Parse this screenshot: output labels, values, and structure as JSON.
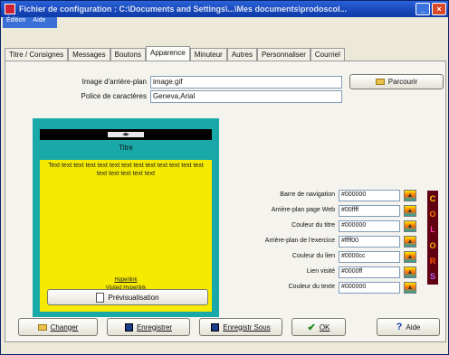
{
  "window": {
    "title": "Fichier de configuration : C:\\Documents and Settings\\...\\Mes documents\\prodoscol...",
    "menu": [
      "Édition",
      "Aide"
    ]
  },
  "tabs": [
    {
      "label": "Titre / Consignes"
    },
    {
      "label": "Messages"
    },
    {
      "label": "Boutons"
    },
    {
      "label": "Apparence"
    },
    {
      "label": "Minuteur"
    },
    {
      "label": "Autres"
    },
    {
      "label": "Personnaliser"
    },
    {
      "label": "Courriel"
    }
  ],
  "form": {
    "bg_image_label": "Image d'arrière-plan",
    "bg_image_value": "image.gif",
    "font_label": "Police de caractères",
    "font_value": "Geneva,Arial",
    "browse_label": "Parcourir"
  },
  "preview": {
    "title": "Titre",
    "body_text": "Text text text text text text text text text text text text text text text text text text",
    "link": "Hyperlink",
    "visited_link": "Visited Hyperlink",
    "preview_button": "Prévisualisation"
  },
  "colors": {
    "rows": [
      {
        "label": "Barre de navigation",
        "value": "#000000"
      },
      {
        "label": "Arrière-plan page Web",
        "value": "#00ffff"
      },
      {
        "label": "Couleur du titre",
        "value": "#000000"
      },
      {
        "label": "Arrière-plan de l'exercice",
        "value": "#ffff00"
      },
      {
        "label": "Couleur du lien",
        "value": "#0000cc"
      },
      {
        "label": "Lien visité",
        "value": "#0000ff"
      },
      {
        "label": "Couleur du texte",
        "value": "#000000"
      }
    ],
    "vertical_label": [
      "C",
      "O",
      "L",
      "O",
      "R",
      "S"
    ]
  },
  "footer": {
    "change": "Changer",
    "save": "Enregistrer",
    "save_as": "Enregistr Sous",
    "ok": "OK",
    "help": "Aide"
  }
}
